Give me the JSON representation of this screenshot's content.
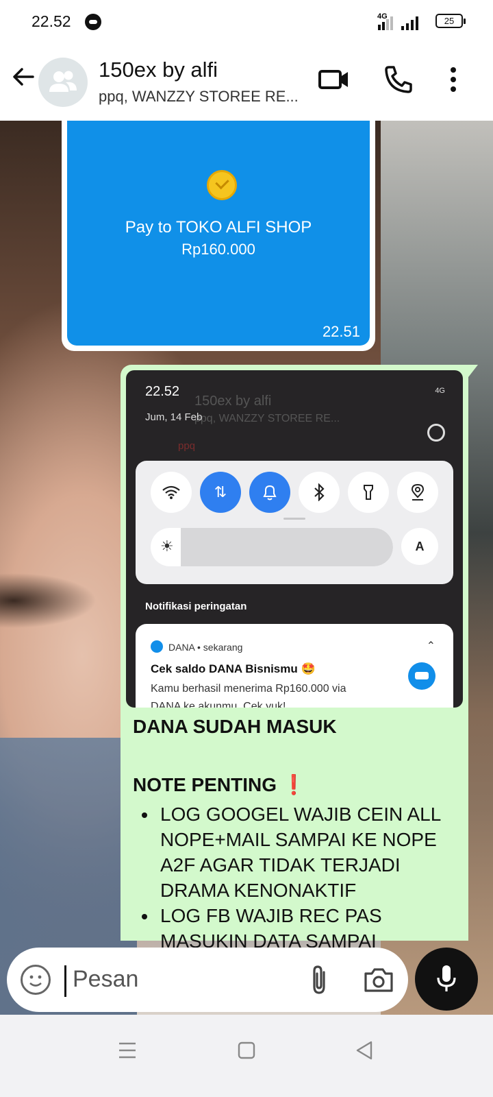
{
  "status": {
    "time": "22.52",
    "network": "4G",
    "battery": "25"
  },
  "header": {
    "title": "150ex by alfi",
    "subtitle": "ppq, WANZZY STOREE RE..."
  },
  "payment": {
    "pay_to": "Pay to TOKO ALFI SHOP",
    "amount": "Rp160.000",
    "timestamp": "22.51"
  },
  "screenshot": {
    "time": "22.52",
    "date": "Jum, 14 Feb",
    "ghost_title": "150ex by alfi",
    "ghost_subtitle": "ppq, WANZZY STOREE RE...",
    "ghost_sender": "ppq",
    "auto_label": "A",
    "notif_section": "Notifikasi peringatan",
    "notif_app": "DANA • sekarang",
    "notif_title": "Cek saldo DANA Bisnismu 🤩",
    "notif_body_1": "Kamu berhasil menerima Rp160.000 via",
    "notif_body_2": "DANA ke akunmu. Cek yuk!"
  },
  "message": {
    "line1": "DANA SUDAH MASUK",
    "line2": "NOTE PENTING",
    "line2_emoji": "❗",
    "bullets": [
      "LOG GOOGEL WAJIB CEIN ALL NOPE+MAIL SAMPAI KE NOPE A2F AGAR TIDAK TERJADI DRAMA KENONAKTIF",
      "LOG FB WAJIB REC PAS MASUKIN DATA SAMPAI"
    ]
  },
  "input": {
    "placeholder": "Pesan"
  }
}
